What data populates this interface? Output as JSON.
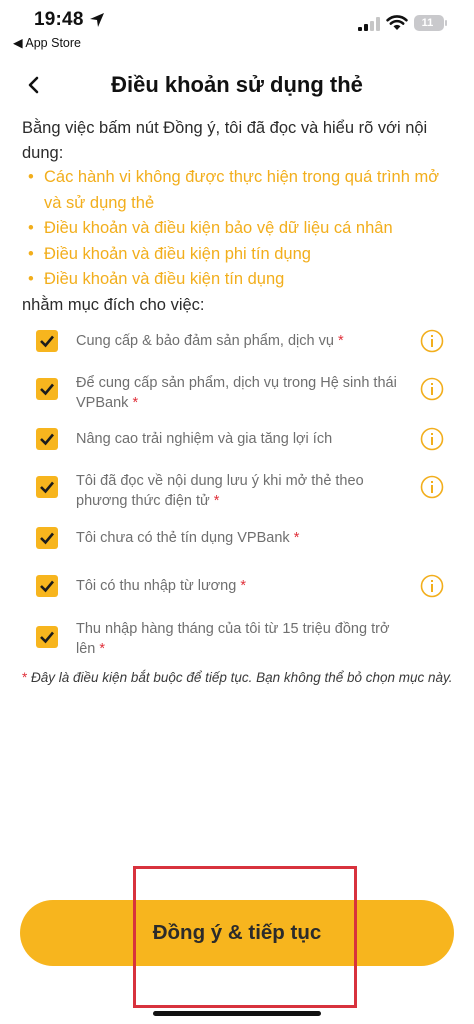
{
  "status_bar": {
    "time": "19:48",
    "back_app": "◀ App Store",
    "battery": "11",
    "icons": [
      "location-arrow-icon",
      "signal-icon",
      "wifi-icon",
      "battery-icon"
    ]
  },
  "header": {
    "back_icon": "chevron-left-icon",
    "title": "Điều khoản sử dụng thẻ"
  },
  "intro": "Bằng việc bấm nút Đồng ý, tôi đã đọc và hiểu rõ với nội dung:",
  "bullets": [
    "Các hành vi không được thực hiện trong quá trình mở và sử dụng thẻ",
    "Điều khoản và điều kiện bảo vệ dữ liệu cá nhân",
    "Điều khoản và điều kiện phi tín dụng",
    "Điều khoản và điều kiện tín dụng"
  ],
  "purpose_label": "nhằm mục đích cho việc:",
  "checklist": [
    {
      "text": "Cung cấp & bảo đảm sản phẩm, dịch vụ",
      "required": "*",
      "checked": true,
      "info": true
    },
    {
      "text": "Để cung cấp sản phẩm, dịch vụ trong Hệ sinh thái VPBank",
      "required": "*",
      "checked": true,
      "info": true
    },
    {
      "text": "Nâng cao trải nghiệm và gia tăng lợi ích",
      "required": "",
      "checked": true,
      "info": true
    },
    {
      "text": "Tôi đã đọc về nội dung lưu ý khi mở thẻ theo phương thức điện tử",
      "required": "*",
      "checked": true,
      "info": true
    },
    {
      "text": "Tôi chưa có thẻ tín dụng VPBank",
      "required": "*",
      "checked": true,
      "info": false
    },
    {
      "text": "Tôi có thu nhập từ lương",
      "required": "*",
      "checked": true,
      "info": true
    },
    {
      "text": "Thu nhập hàng tháng của tôi từ 15 triệu đồng trở lên",
      "required": "*",
      "checked": true,
      "info": false
    }
  ],
  "note": {
    "star": "*",
    "text": " Đây là điều kiện bắt buộc để tiếp tục. Bạn không thể bỏ chọn mục này."
  },
  "agree_button": "Đồng ý & tiếp tục",
  "colors": {
    "accent": "#f7b51e",
    "bullet_text": "#f2ae1c",
    "required": "#e0303a",
    "highlight_box": "#d8323d"
  }
}
